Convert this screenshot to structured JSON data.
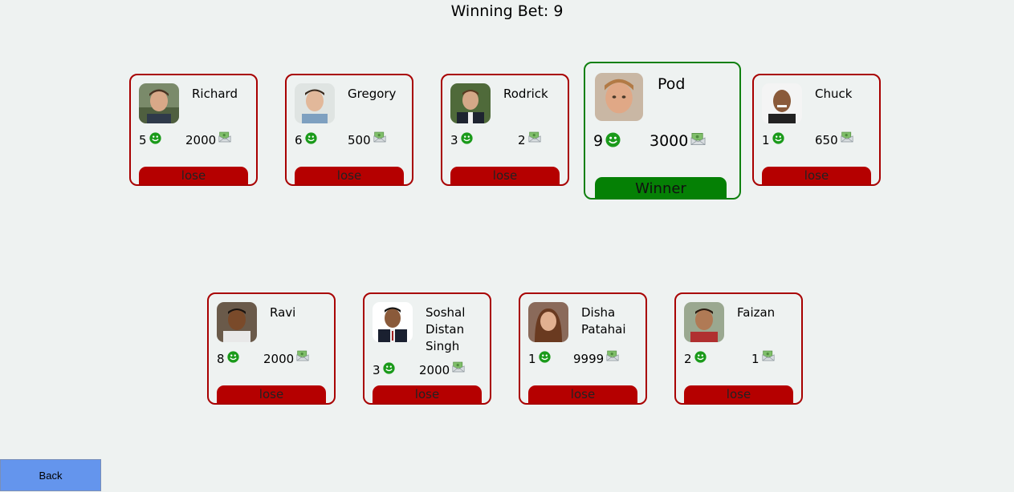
{
  "header": {
    "winning_bet": "Winning Bet: 9"
  },
  "colors": {
    "lose": "#b50000",
    "winner": "#058005",
    "lose_border": "#a80000",
    "winner_border": "#108010",
    "back_button": "#6495ed"
  },
  "players": [
    {
      "name": "Richard",
      "bets": "5",
      "money": "2000",
      "result": "lose",
      "avatar_icon": "player-photo-icon"
    },
    {
      "name": "Gregory",
      "bets": "6",
      "money": "500",
      "result": "lose",
      "avatar_icon": "player-photo-icon"
    },
    {
      "name": "Rodrick",
      "bets": "3",
      "money": "2",
      "result": "lose",
      "avatar_icon": "player-photo-icon"
    },
    {
      "name": "Pod",
      "bets": "9",
      "money": "3000",
      "result": "Winner",
      "avatar_icon": "player-photo-icon"
    },
    {
      "name": "Chuck",
      "bets": "1",
      "money": "650",
      "result": "lose",
      "avatar_icon": "player-photo-icon"
    },
    {
      "name": "Ravi",
      "bets": "8",
      "money": "2000",
      "result": "lose",
      "avatar_icon": "player-photo-icon"
    },
    {
      "name": "Soshal Distan Singh",
      "bets": "3",
      "money": "2000",
      "result": "lose",
      "avatar_icon": "player-photo-icon"
    },
    {
      "name": "Disha Patahai",
      "bets": "1",
      "money": "9999",
      "result": "lose",
      "avatar_icon": "player-photo-icon"
    },
    {
      "name": "Faizan",
      "bets": "2",
      "money": "1",
      "result": "lose",
      "avatar_icon": "player-photo-icon"
    }
  ],
  "footer": {
    "back_label": "Back"
  }
}
